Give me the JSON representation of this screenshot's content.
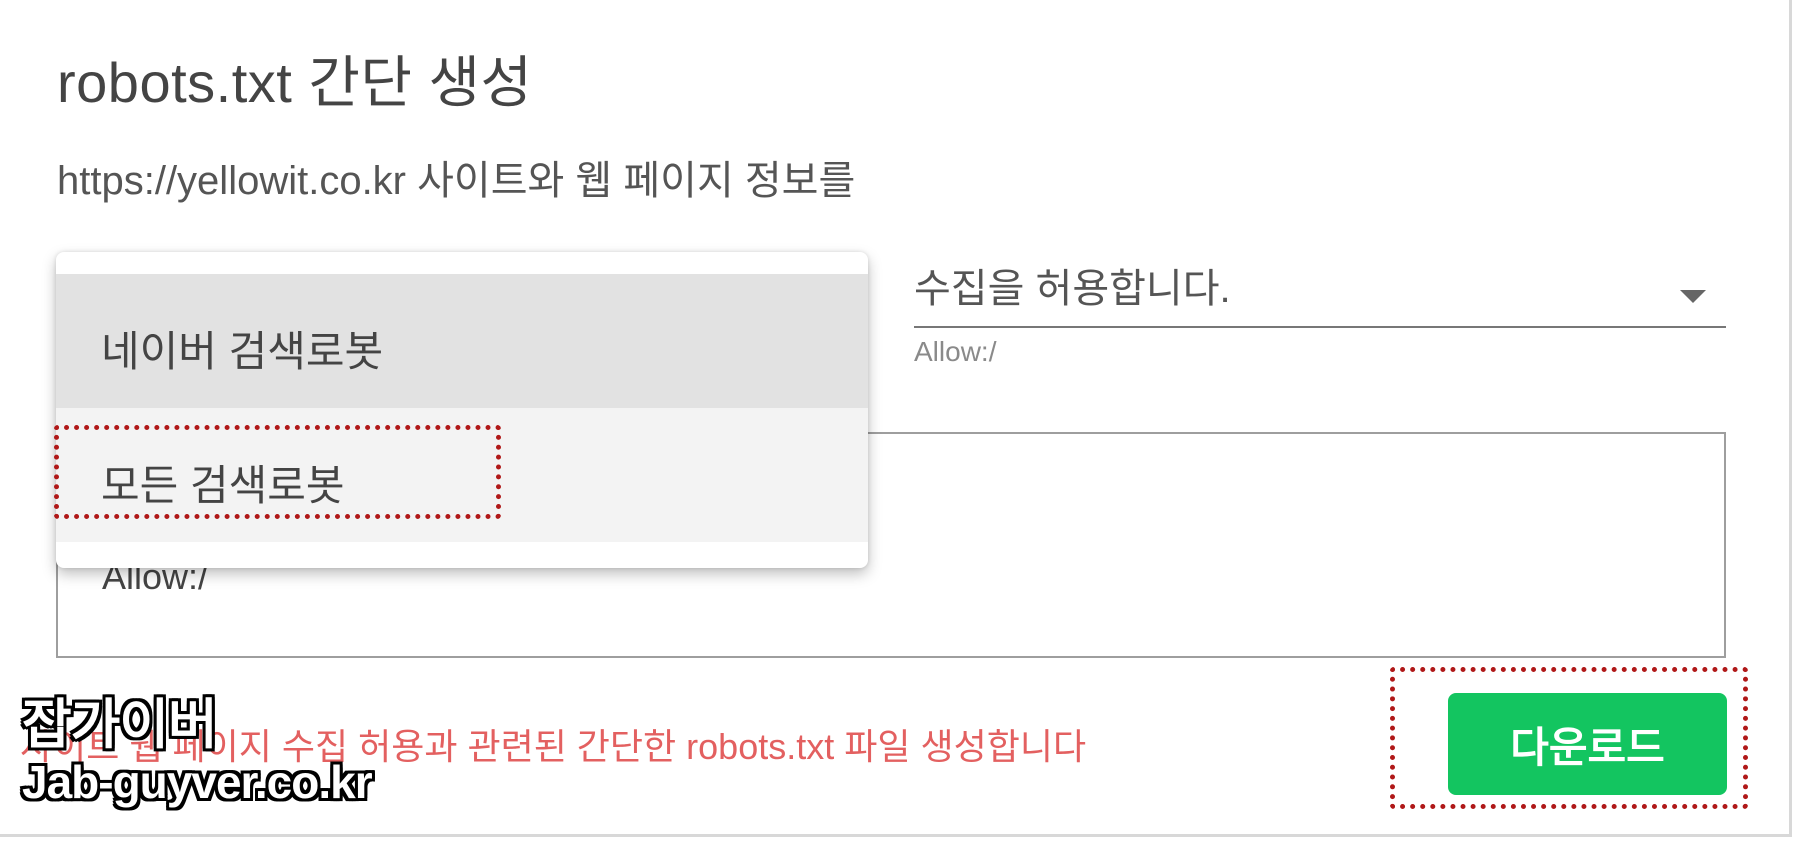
{
  "page": {
    "title": "robots.txt 간단 생성",
    "subtitle": "https://yellowit.co.kr 사이트와 웹 페이지 정보를"
  },
  "bot_select": {
    "options": [
      "네이버 검색로봇",
      "모든 검색로봇"
    ]
  },
  "permission_select": {
    "value": "수집을 허용합니다.",
    "hint": "Allow:/"
  },
  "output": {
    "text": "Allow:/"
  },
  "footer": {
    "info": "사이트 웹 페이지 수집 허용과 관련된 간단한 robots.txt 파일 생성합니다",
    "download_label": "다운로드"
  },
  "watermark": {
    "line1": "잡가이버",
    "line2": "Jab-guyver.co.kr"
  },
  "colors": {
    "download_bg": "#13c560",
    "info_text": "#e36060",
    "highlight_border": "#b01818"
  }
}
